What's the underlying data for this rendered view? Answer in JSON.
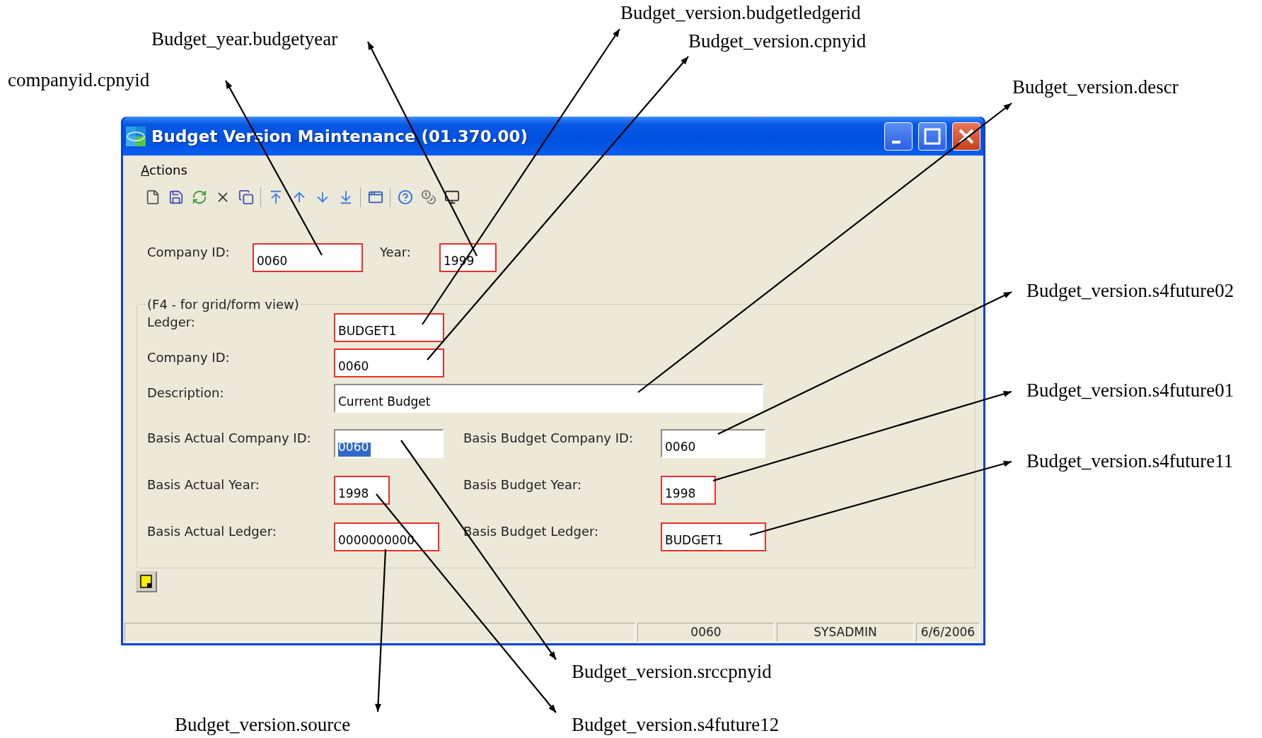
{
  "window": {
    "title": "Budget Version Maintenance (01.370.00)"
  },
  "menu": [
    {
      "label": "Actions"
    }
  ],
  "top_fields": [
    {
      "label": "Company ID:",
      "value": "0060",
      "required": true,
      "selected": false
    },
    {
      "label": "Year:",
      "value": "1999",
      "required": true,
      "selected": false
    }
  ],
  "group": {
    "legend": "(F4 - for grid/form view)",
    "fields": [
      {
        "label": "Ledger:",
        "value": "BUDGET1",
        "required": true,
        "selected": false
      },
      {
        "label": "Company ID:",
        "value": "0060",
        "required": true,
        "selected": false
      },
      {
        "label": "Description:",
        "value": "Current Budget",
        "required": false,
        "selected": false
      }
    ],
    "basis_rows": [
      {
        "left": {
          "label": "Basis Actual Company ID:",
          "value": "0060",
          "required": false,
          "selected": true
        },
        "right": {
          "label": "Basis Budget Company ID:",
          "value": "0060",
          "required": false,
          "selected": false
        }
      },
      {
        "left": {
          "label": "Basis Actual Year:",
          "value": "1998",
          "required": true,
          "selected": false
        },
        "right": {
          "label": "Basis Budget Year:",
          "value": "1998",
          "required": true,
          "selected": false
        }
      },
      {
        "left": {
          "label": "Basis Actual Ledger:",
          "value": "0000000000",
          "required": true,
          "selected": false
        },
        "right": {
          "label": "Basis Budget Ledger:",
          "value": "BUDGET1",
          "required": true,
          "selected": false
        }
      }
    ]
  },
  "status_bar": [
    "0060",
    "SYSADMIN",
    "6/6/2006"
  ],
  "annotations": [
    {
      "label": "companyid.cpnyid"
    },
    {
      "label": "Budget_year.budgetyear"
    },
    {
      "label": "Budget_version.budgetledgerid"
    },
    {
      "label": "Budget_version.cpnyid"
    },
    {
      "label": "Budget_version.descr"
    },
    {
      "label": "Budget_version.s4future02"
    },
    {
      "label": "Budget_version.s4future01"
    },
    {
      "label": "Budget_version.s4future11"
    },
    {
      "label": "Budget_version.srccpnyid"
    },
    {
      "label": "Budget_version.source"
    },
    {
      "label": "Budget_version.s4future12"
    }
  ]
}
